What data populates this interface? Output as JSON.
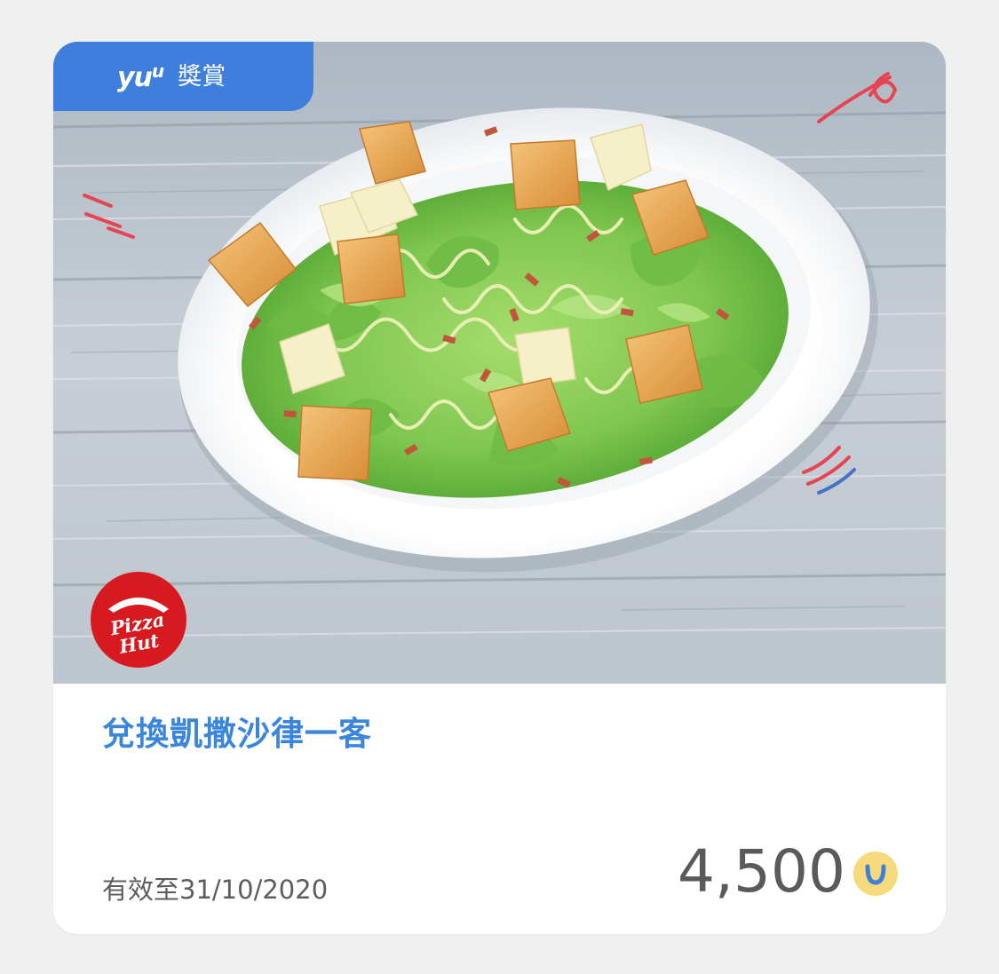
{
  "badge": {
    "logo_text": "yu",
    "logo_sup": "u",
    "label": "獎賞"
  },
  "offer": {
    "title": "兌換凱撒沙律一客",
    "validity": "有效至31/10/2020",
    "points": "4,500",
    "points_icon": "u"
  },
  "brand": {
    "logo_line1": "Pizza",
    "logo_line2": "Hut"
  },
  "colors": {
    "accent": "#3e7fde",
    "title": "#3a86dc",
    "brand_red": "#d71920",
    "coin": "#f6da7c"
  }
}
